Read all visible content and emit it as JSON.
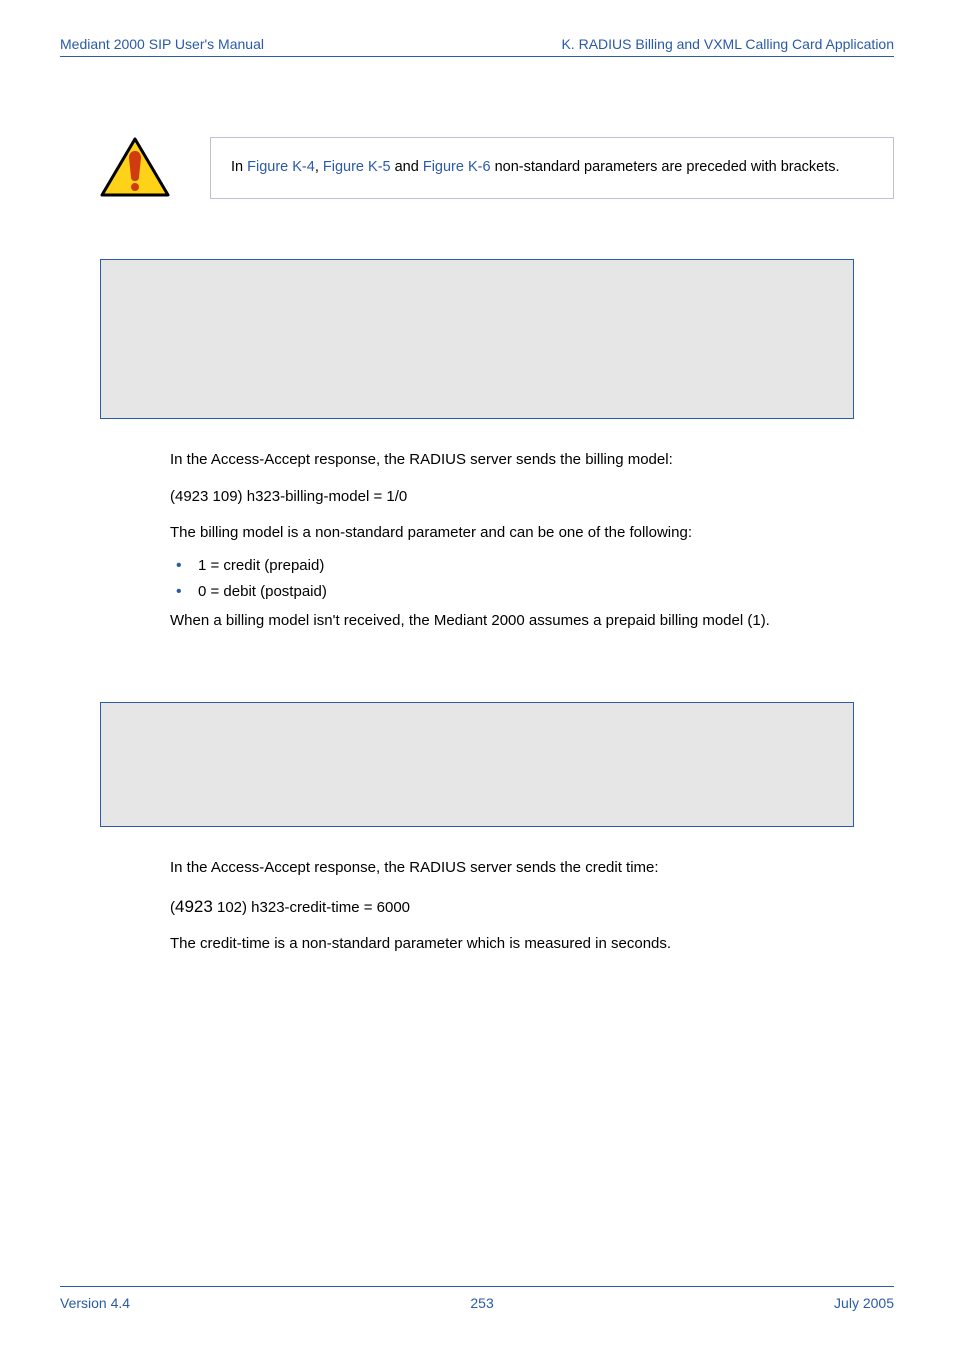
{
  "header": {
    "left": "Mediant 2000 SIP User's Manual",
    "right": "K. RADIUS Billing and VXML Calling Card Application"
  },
  "warning": {
    "pre": "In ",
    "link1": "Figure K-4",
    "sep1": ", ",
    "link2": "Figure K-5",
    "sep2": " and ",
    "link3": "Figure K-6",
    "post": " non-standard parameters are preceded with brackets."
  },
  "section1": {
    "p1": "In the Access-Accept response, the RADIUS server sends the billing model:",
    "p2": "(4923 109) h323-billing-model = 1/0",
    "p3": "The billing model is a non-standard parameter and can be one of the following:",
    "li1": "1 = credit (prepaid)",
    "li2": "0 = debit (postpaid)",
    "p4": "When a billing model isn't received, the Mediant 2000 assumes a prepaid billing model (1)."
  },
  "section2": {
    "p1": "In the Access-Accept response, the RADIUS server sends the credit time:",
    "p2_a": "(",
    "p2_b": "4923",
    "p2_c": " 102) h323-credit-time = 6000",
    "p3": "The credit-time is a non-standard parameter which is measured in seconds."
  },
  "footer": {
    "left": "Version 4.4",
    "center": "253",
    "right": "July 2005"
  }
}
